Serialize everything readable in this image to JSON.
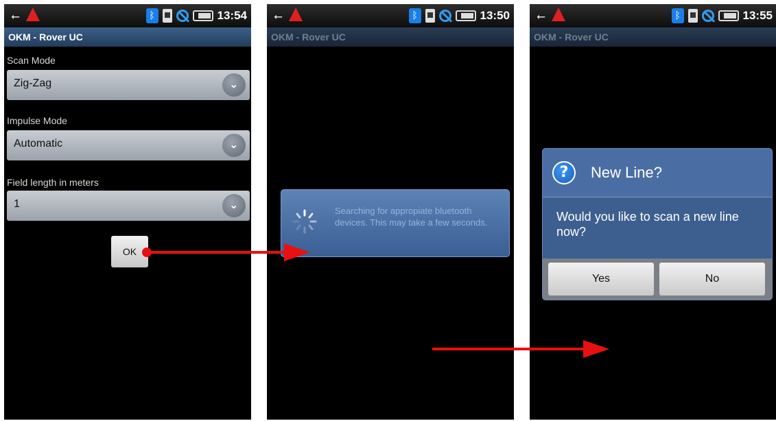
{
  "screens": [
    {
      "status": {
        "time": "13:54"
      },
      "app_title": "OKM - Rover UC",
      "fields": [
        {
          "label": "Scan Mode",
          "value": "Zig-Zag"
        },
        {
          "label": "Impulse Mode",
          "value": "Automatic"
        },
        {
          "label": "Field length in meters",
          "value": "1"
        }
      ],
      "ok_label": "OK"
    },
    {
      "status": {
        "time": "13:50"
      },
      "app_title": "OKM - Rover UC",
      "progress_text": "Searching for appropiate bluetooth devices. This may take a few seconds."
    },
    {
      "status": {
        "time": "13:55"
      },
      "app_title": "OKM - Rover UC",
      "dialog": {
        "title": "New Line?",
        "message": "Would you like to scan a new line now?",
        "yes_label": "Yes",
        "no_label": "No"
      }
    }
  ],
  "icons": [
    "usb-icon",
    "warning-icon",
    "bluetooth-icon",
    "sd-card-icon",
    "no-signal-icon",
    "battery-icon",
    "dropdown-chevron-icon",
    "loading-spinner-icon",
    "question-icon",
    "arrow-icon"
  ],
  "colors": {
    "arrow": "#e81010",
    "title_bar": "#2f4f74",
    "dialog": "#3d5f8f"
  }
}
